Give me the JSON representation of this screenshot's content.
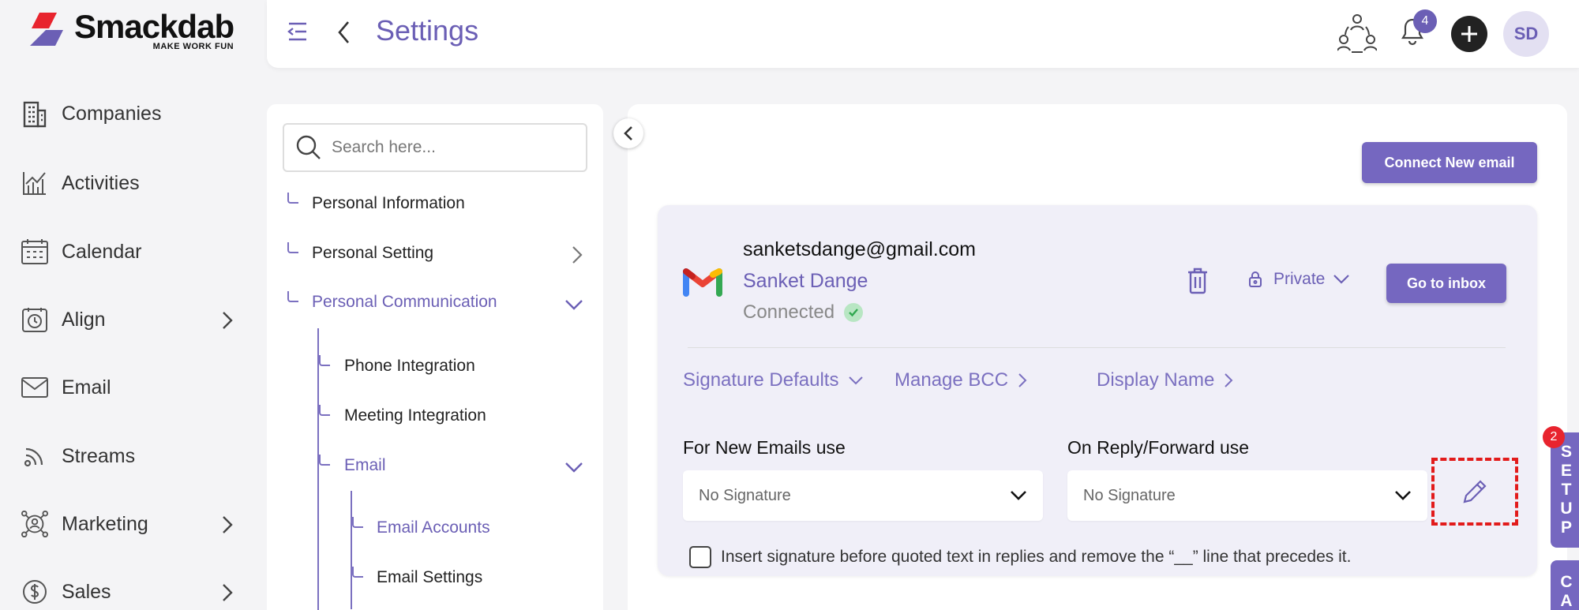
{
  "brand": {
    "name": "Smackdab",
    "tagline": "MAKE WORK FUN",
    "accent_color": "#6b5fb5",
    "alert_color": "#e8242e"
  },
  "sidebar": {
    "items": [
      {
        "label": "Companies",
        "icon": "building-icon",
        "has_submenu": false
      },
      {
        "label": "Activities",
        "icon": "activity-chart-icon",
        "has_submenu": false
      },
      {
        "label": "Calendar",
        "icon": "calendar-icon",
        "has_submenu": false
      },
      {
        "label": "Align",
        "icon": "clock-calendar-icon",
        "has_submenu": true
      },
      {
        "label": "Email",
        "icon": "mail-icon",
        "has_submenu": false
      },
      {
        "label": "Streams",
        "icon": "rss-icon",
        "has_submenu": false
      },
      {
        "label": "Marketing",
        "icon": "network-person-icon",
        "has_submenu": true
      },
      {
        "label": "Sales",
        "icon": "dollar-icon",
        "has_submenu": true
      }
    ]
  },
  "header": {
    "title": "Settings",
    "notification_count": "4",
    "avatar_initials": "SD"
  },
  "settings_nav": {
    "search_placeholder": "Search here...",
    "items": {
      "personal_information": "Personal Information",
      "personal_setting": "Personal Setting",
      "personal_communication": "Personal Communication",
      "phone_integration": "Phone Integration",
      "meeting_integration": "Meeting Integration",
      "email": "Email",
      "email_accounts": "Email Accounts",
      "email_settings": "Email Settings"
    }
  },
  "main": {
    "connect_button": "Connect New email",
    "account": {
      "email": "sanketsdange@gmail.com",
      "name": "Sanket Dange",
      "status": "Connected",
      "visibility": "Private",
      "inbox_button": "Go to inbox"
    },
    "subtabs": [
      "Signature Defaults",
      "Manage BCC",
      "Display Name"
    ],
    "new_emails_label": "For New Emails use",
    "new_emails_value": "No Signature",
    "reply_label": "On Reply/Forward use",
    "reply_value": "No Signature",
    "insert_signature_label": "Insert signature before quoted text in replies and remove the “__” line that precedes it.",
    "insert_signature_checked": false
  },
  "right_tabs": {
    "setup_letters": [
      "S",
      "E",
      "T",
      "U",
      "P"
    ],
    "setup_badge": "2",
    "ca_letters": [
      "C",
      "A"
    ]
  }
}
